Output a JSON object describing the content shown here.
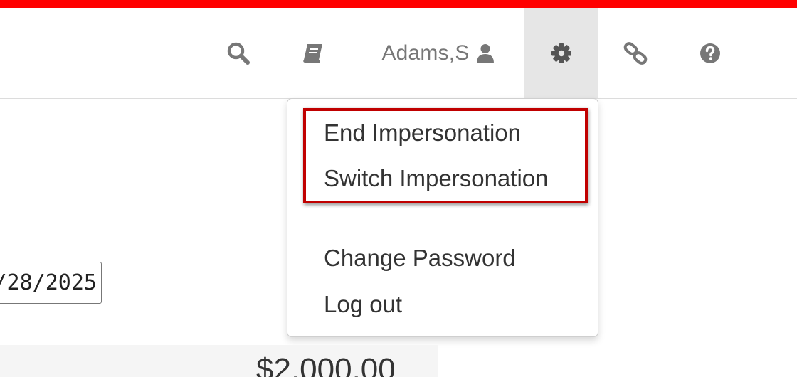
{
  "header": {
    "user_name": "Adams,S",
    "icons": [
      "search-icon",
      "book-icon",
      "user-icon",
      "gear-icon",
      "link-icon",
      "help-icon"
    ]
  },
  "settings_menu": {
    "items": [
      {
        "label": "End Impersonation"
      },
      {
        "label": "Switch Impersonation"
      },
      {
        "label": "Change Password"
      },
      {
        "label": "Log out"
      }
    ]
  },
  "form": {
    "date_value": "/28/2025",
    "amount": "$2,000.00"
  },
  "colors": {
    "top_bar": "#ff0000",
    "highlight": "#c00000",
    "active_nav_bg": "#e6e6e6"
  }
}
